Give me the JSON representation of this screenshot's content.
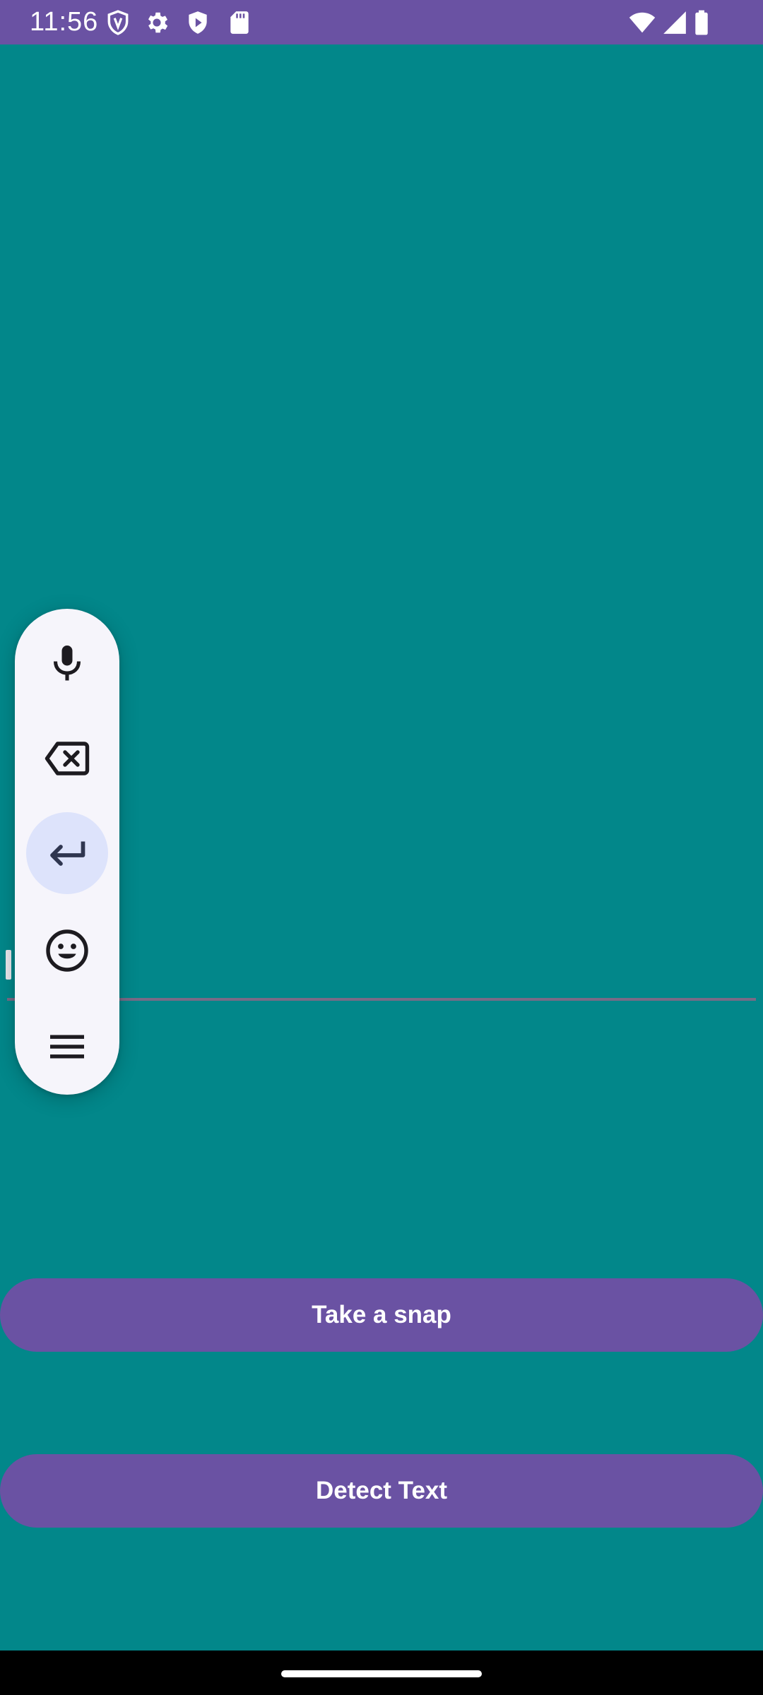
{
  "status_bar": {
    "time": "11:56",
    "icons": [
      "vpn-shield-icon",
      "settings-gear-icon",
      "play-protect-icon",
      "sd-card-icon",
      "wifi-icon",
      "cellular-signal-icon",
      "battery-icon"
    ]
  },
  "floating_toolbar": {
    "buttons": [
      "microphone-icon",
      "backspace-icon",
      "enter-icon",
      "emoji-icon",
      "menu-icon"
    ],
    "active_button": "enter-icon"
  },
  "actions": {
    "take_snap_label": "Take a snap",
    "detect_text_label": "Detect Text"
  },
  "colors": {
    "background": "#02878a",
    "primary": "#6a52a3",
    "toolbar_background": "#f6f5fb",
    "toolbar_active": "#dde3fb"
  }
}
